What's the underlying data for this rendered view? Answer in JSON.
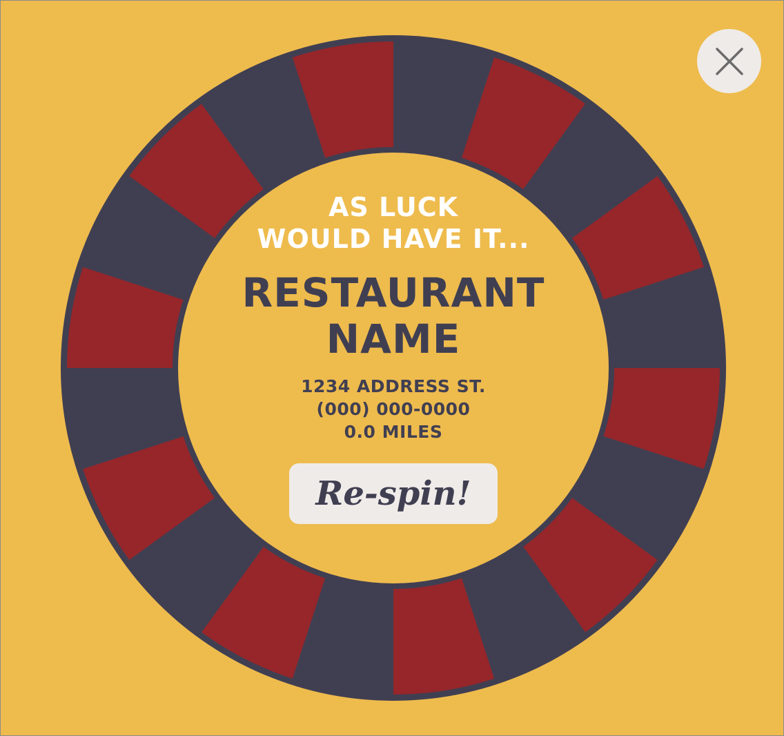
{
  "colors": {
    "background": "#eebb4d",
    "wheel_dark": "#403f52",
    "wheel_red": "#96262a",
    "button_bg": "#efebe8",
    "text_dark": "#403f52",
    "text_light": "#ffffff"
  },
  "wheel": {
    "segments": 20,
    "pattern": [
      "dark",
      "red"
    ]
  },
  "close_button": {
    "icon": "close-icon"
  },
  "result": {
    "tagline_line1": "AS LUCK",
    "tagline_line2": "WOULD HAVE IT...",
    "name_line1": "RESTAURANT",
    "name_line2": "NAME",
    "address": "1234 ADDRESS ST.",
    "phone": "(000) 000-0000",
    "distance": "0.0 MILES"
  },
  "respin_button": {
    "label": "Re-spin!"
  }
}
